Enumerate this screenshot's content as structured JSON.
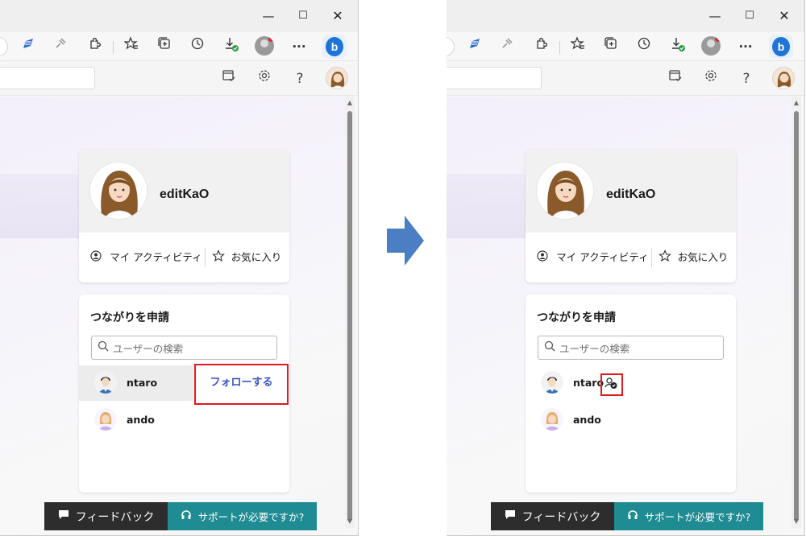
{
  "window": {
    "minimize": "—",
    "maximize": "☐",
    "close": "✕"
  },
  "toolbar": {
    "icons": [
      "pen-icon",
      "pin-icon",
      "extensions-icon",
      "favorites-icon",
      "collections-icon",
      "history-icon",
      "downloads-icon",
      "profile-icon",
      "more-icon",
      "bing-icon"
    ],
    "more": "···",
    "bing": "b"
  },
  "appbar": {
    "help": "?"
  },
  "profile": {
    "name": "editKaO",
    "activity_label": "マイ アクティビティ",
    "favorites_label": "お気に入り"
  },
  "connections": {
    "title": "つながりを申請",
    "search_placeholder": "ユーザーの検索",
    "users": [
      {
        "name": "ntaro"
      },
      {
        "name": "ando"
      }
    ],
    "follow_label": "フォローする"
  },
  "footer": {
    "feedback_label": "フィードバック",
    "support_label": "サポートが必要ですか?"
  },
  "colors": {
    "accent_blue": "#3b52c4",
    "highlight_red": "#e0191f",
    "support_teal": "#1f8b92",
    "feedback_dark": "#2d2d2d",
    "arrow_blue": "#4a7fc4"
  }
}
